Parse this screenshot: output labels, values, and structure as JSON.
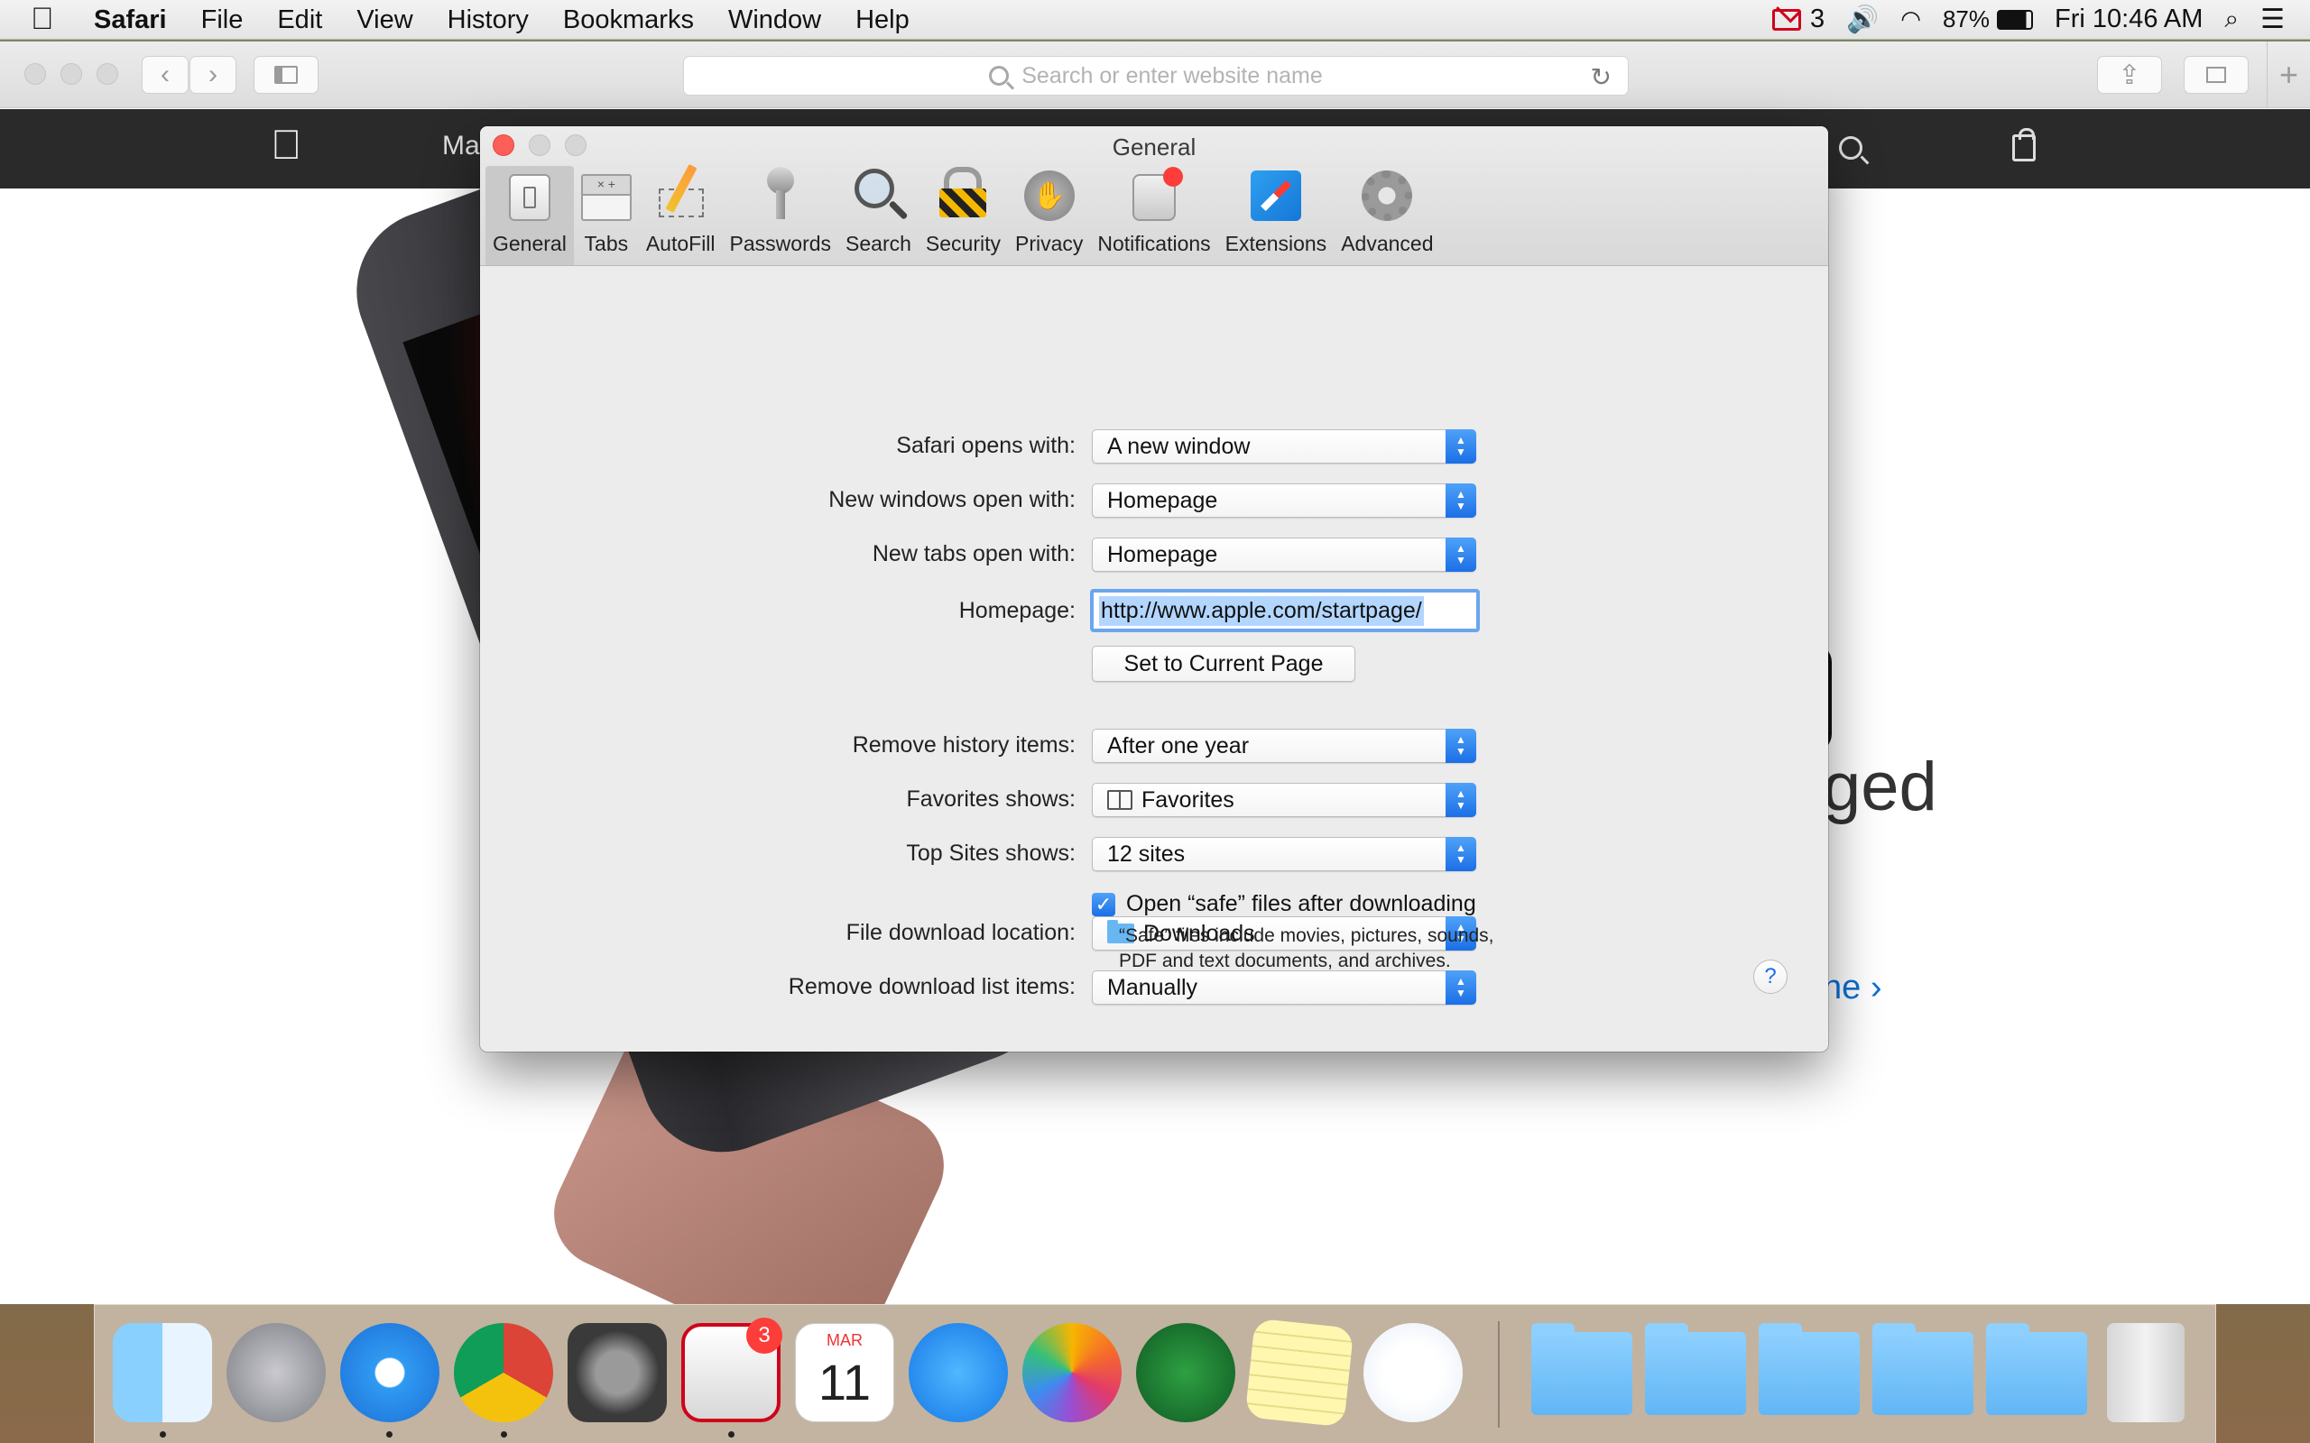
{
  "menubar": {
    "app_name": "Safari",
    "items": [
      "File",
      "Edit",
      "View",
      "History",
      "Bookmarks",
      "Window",
      "Help"
    ],
    "mail_count": "3",
    "battery": "87%",
    "clock": "Fri 10:46 AM"
  },
  "safari": {
    "address_placeholder": "Search or enter website name"
  },
  "webpage": {
    "nav_partial": "Ma",
    "hero_partial": "ged",
    "link_partial": "ne ›"
  },
  "prefs": {
    "title": "General",
    "tabs": [
      {
        "label": "General",
        "icon": "general-icon"
      },
      {
        "label": "Tabs",
        "icon": "tabs-icon"
      },
      {
        "label": "AutoFill",
        "icon": "autofill-icon"
      },
      {
        "label": "Passwords",
        "icon": "passwords-icon"
      },
      {
        "label": "Search",
        "icon": "search-icon"
      },
      {
        "label": "Security",
        "icon": "security-icon"
      },
      {
        "label": "Privacy",
        "icon": "privacy-icon"
      },
      {
        "label": "Notifications",
        "icon": "notifications-icon"
      },
      {
        "label": "Extensions",
        "icon": "extensions-icon"
      },
      {
        "label": "Advanced",
        "icon": "advanced-icon"
      }
    ],
    "fields": {
      "safari_opens_with": {
        "label": "Safari opens with:",
        "value": "A new window"
      },
      "new_windows_open_with": {
        "label": "New windows open with:",
        "value": "Homepage"
      },
      "new_tabs_open_with": {
        "label": "New tabs open with:",
        "value": "Homepage"
      },
      "homepage": {
        "label": "Homepage:",
        "value": "http://www.apple.com/startpage/"
      },
      "set_current_page": "Set to Current Page",
      "remove_history": {
        "label": "Remove history items:",
        "value": "After one year"
      },
      "favorites_shows": {
        "label": "Favorites shows:",
        "value": "Favorites"
      },
      "top_sites_shows": {
        "label": "Top Sites shows:",
        "value": "12 sites"
      },
      "download_location": {
        "label": "File download location:",
        "value": "Downloads"
      },
      "remove_download_list": {
        "label": "Remove download list items:",
        "value": "Manually"
      },
      "open_safe_files": {
        "label": "Open “safe” files after downloading",
        "checked": true
      },
      "safe_files_help": "“Safe” files include movies, pictures, sounds, PDF and text documents, and archives."
    },
    "help_glyph": "?"
  },
  "dock": {
    "apps": [
      "Finder",
      "Launchpad",
      "Safari",
      "Google Chrome",
      "System Preferences",
      "Mail",
      "Calendar",
      "App Store",
      "Photos",
      "Solitaire",
      "Notes",
      "Weather",
      "Folder",
      "Folder",
      "Folder",
      "Folder",
      "Folder",
      "Trash"
    ],
    "mail_badge": "3",
    "calendar_month": "MAR",
    "calendar_day": "11"
  },
  "colors": {
    "accent": "#1b6fe6",
    "close_red": "#fc5f57",
    "selection": "#b3d6fe"
  }
}
